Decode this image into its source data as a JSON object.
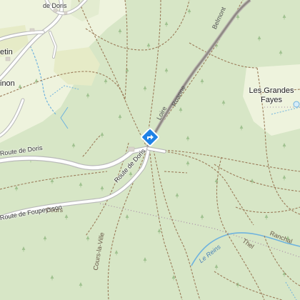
{
  "map": {
    "labels": {
      "route_doris_top": "de Doris",
      "route_doris_left": "Route de Doris",
      "route_doris_mid": "Route de Doris",
      "route_foupeysson": "Route de Foupeysson",
      "cours_short": "Cours",
      "cours_la_ville": "Cours-la-Ville",
      "belmont": "Belmont",
      "roanne": "Roanne",
      "loire": "Loire",
      "etin": "etin",
      "inon": "inon",
      "les_grandes_fayes_line1": "Les Grandes",
      "les_grandes_fayes_line2": "Fayes",
      "ranchal": "Ranchal",
      "le_reins": "Le Reins",
      "thel": "Thel"
    },
    "marker": {
      "icon": "directions-diamond-icon",
      "color": "#1f82e6"
    },
    "colors": {
      "forest": "#d7e6c6",
      "meadow": "#eef3dd",
      "field": "#e6ebc7",
      "road_casing": "#b9b9b9",
      "road_fill": "#ffffff",
      "main_road": "#8f8a84",
      "trail": "#9b7c5a",
      "water": "#6fb3de",
      "boundary": "#a78aa6"
    }
  }
}
